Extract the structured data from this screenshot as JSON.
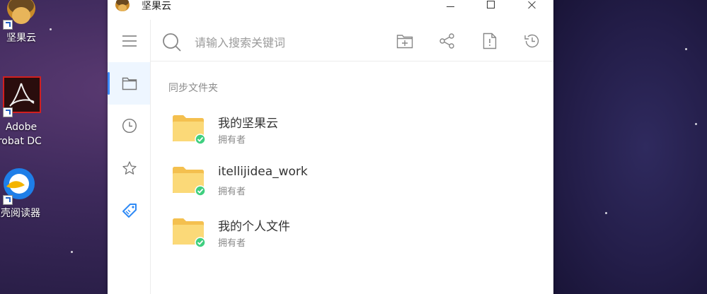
{
  "desktop": {
    "icons": [
      {
        "label": "坚果云"
      },
      {
        "label_line1": "Adobe",
        "label_line2": "crobat DC"
      },
      {
        "label": "搜壳阅读器"
      }
    ]
  },
  "window": {
    "title": "坚果云",
    "search": {
      "placeholder": "请输入搜索关键词",
      "value": ""
    },
    "section_label": "同步文件夹",
    "folders": [
      {
        "name": "我的坚果云",
        "owner": "拥有者"
      },
      {
        "name": "itellijidea_work",
        "owner": "拥有者"
      },
      {
        "name": "我的个人文件",
        "owner": "拥有者"
      }
    ],
    "sidebar_icons": [
      "menu-icon",
      "folder-icon",
      "clock-icon",
      "star-icon",
      "tag-icon"
    ],
    "toolbar_icons": [
      "new-folder-icon",
      "share-icon",
      "file-alert-icon",
      "history-icon"
    ],
    "colors": {
      "accent": "#3d8bff",
      "folder": "#f9cf6a",
      "check": "#3fcf7f",
      "active_bg": "#eef6ff"
    }
  }
}
